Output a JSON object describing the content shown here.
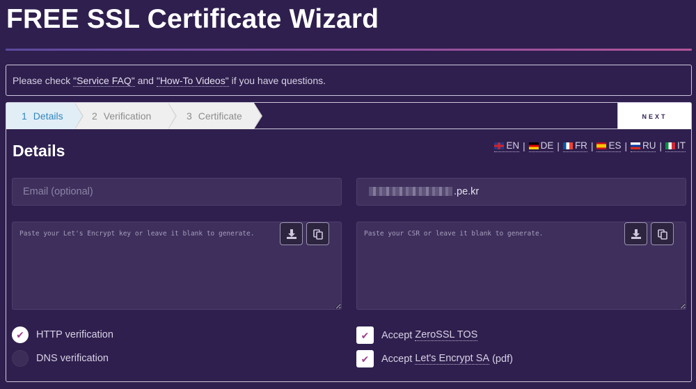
{
  "header": {
    "title": "FREE SSL Certificate Wizard"
  },
  "notice": {
    "prefix": "Please check ",
    "faq_link": "\"Service FAQ\"",
    "middle": " and ",
    "videos_link": "\"How-To Videos\"",
    "suffix": " if you have questions."
  },
  "steps": [
    {
      "num": "1",
      "label": "Details",
      "active": true
    },
    {
      "num": "2",
      "label": "Verification",
      "active": false
    },
    {
      "num": "3",
      "label": "Certificate",
      "active": false
    }
  ],
  "next_label": "NEXT",
  "details": {
    "title": "Details",
    "languages": [
      {
        "flag": "uk-flag-icon",
        "code": "EN"
      },
      {
        "flag": "de-flag-icon",
        "code": "DE"
      },
      {
        "flag": "fr-flag-icon",
        "code": "FR"
      },
      {
        "flag": "es-flag-icon",
        "code": "ES"
      },
      {
        "flag": "ru-flag-icon",
        "code": "RU"
      },
      {
        "flag": "it-flag-icon",
        "code": "IT"
      }
    ],
    "email": {
      "value": "",
      "placeholder": "Email (optional)"
    },
    "domain": {
      "value_visible": ".pe.kr"
    },
    "key": {
      "placeholder": "Paste your Let's Encrypt key or leave it blank to generate."
    },
    "csr": {
      "placeholder": "Paste your CSR or leave it blank to generate."
    },
    "verification": [
      {
        "label": "HTTP verification",
        "selected": true
      },
      {
        "label": "DNS verification",
        "selected": false
      }
    ],
    "agreements": [
      {
        "prefix": "Accept ",
        "link": "ZeroSSL TOS",
        "suffix": "",
        "checked": true
      },
      {
        "prefix": "Accept ",
        "link": "Let's Encrypt SA",
        "suffix": " (pdf)",
        "checked": true
      }
    ]
  },
  "colors": {
    "background": "#2f1f4e",
    "accent": "#9c3f8f",
    "active_step": "#2f86c0"
  }
}
